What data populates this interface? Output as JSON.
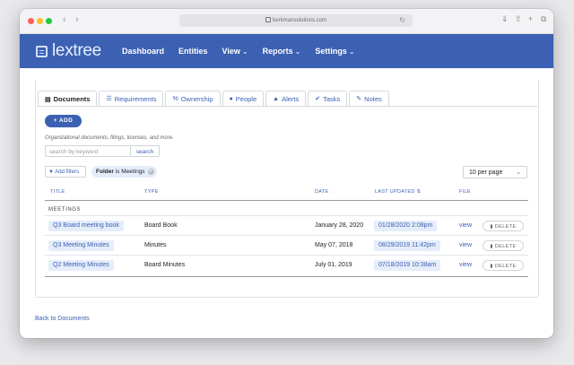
{
  "browser": {
    "url": "berkmansolutions.com"
  },
  "app": {
    "logo_text": "lextree",
    "accent": "#3c61b3",
    "nav": [
      {
        "label": "Dashboard",
        "has_dropdown": false
      },
      {
        "label": "Entities",
        "has_dropdown": false
      },
      {
        "label": "View",
        "has_dropdown": true
      },
      {
        "label": "Reports",
        "has_dropdown": true
      },
      {
        "label": "Settings",
        "has_dropdown": true
      }
    ]
  },
  "tabs": [
    {
      "label": "Documents",
      "icon": "document-icon",
      "active": true
    },
    {
      "label": "Requirements",
      "icon": "list-icon",
      "active": false
    },
    {
      "label": "Ownership",
      "icon": "percent-icon",
      "active": false
    },
    {
      "label": "People",
      "icon": "person-icon",
      "active": false
    },
    {
      "label": "Alerts",
      "icon": "bell-icon",
      "active": false
    },
    {
      "label": "Tasks",
      "icon": "check-circle-icon",
      "active": false
    },
    {
      "label": "Notes",
      "icon": "edit-icon",
      "active": false
    }
  ],
  "add_button": "+ ADD",
  "description": "Organizational documents, filings, licenses, and more.",
  "search": {
    "placeholder": "search by keyword",
    "button": "search"
  },
  "filters": {
    "add_label": "Add filters",
    "chip_key": "Folder",
    "chip_op": " is ",
    "chip_value": "Meetings"
  },
  "per_page": "10 per page",
  "table": {
    "headers": [
      "TITLE",
      "TYPE",
      "DATE",
      "LAST UPDATED",
      "FILE"
    ],
    "group": "MEETINGS",
    "rows": [
      {
        "title": "Q3 Board meeting book",
        "type": "Board Book",
        "date": "January 28, 2020",
        "updated": "01/28/2020 2:08pm",
        "file": "view",
        "action": "DELETE"
      },
      {
        "title": "Q3 Meeting Minutes",
        "type": "Minutes",
        "date": "May 07, 2018",
        "updated": "08/29/2019 11:42pm",
        "file": "view",
        "action": "DELETE"
      },
      {
        "title": "Q2 Meeting Minutes",
        "type": "Board Minutes",
        "date": "July 01, 2019",
        "updated": "07/18/2019 10:38am",
        "file": "view",
        "action": "DELETE"
      }
    ]
  },
  "back_link": "Back to Documents"
}
